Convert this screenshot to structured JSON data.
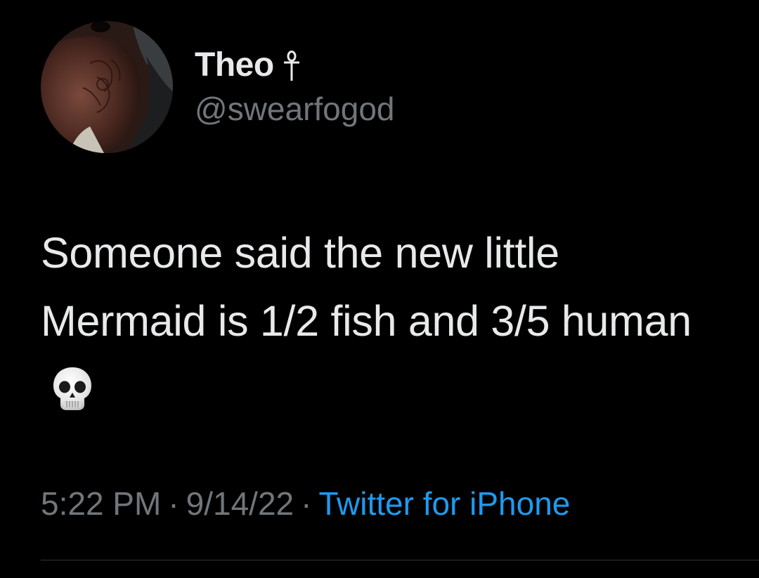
{
  "author": {
    "display_name": "Theo",
    "name_icon": "ankh-icon",
    "handle": "@swearfogod",
    "avatar_icon": "profile-photo"
  },
  "tweet": {
    "text": "Someone said the new little Mermaid is 1/2 fish and 3/5 human",
    "emoji": "skull-emoji",
    "time": "5:22 PM",
    "date": "9/14/22",
    "separator": "·",
    "source": "Twitter for iPhone"
  },
  "colors": {
    "background": "#000000",
    "primary_text": "#e7e9ea",
    "secondary_text": "#71767b",
    "link": "#1d9bf0",
    "divider": "#2f3336"
  }
}
